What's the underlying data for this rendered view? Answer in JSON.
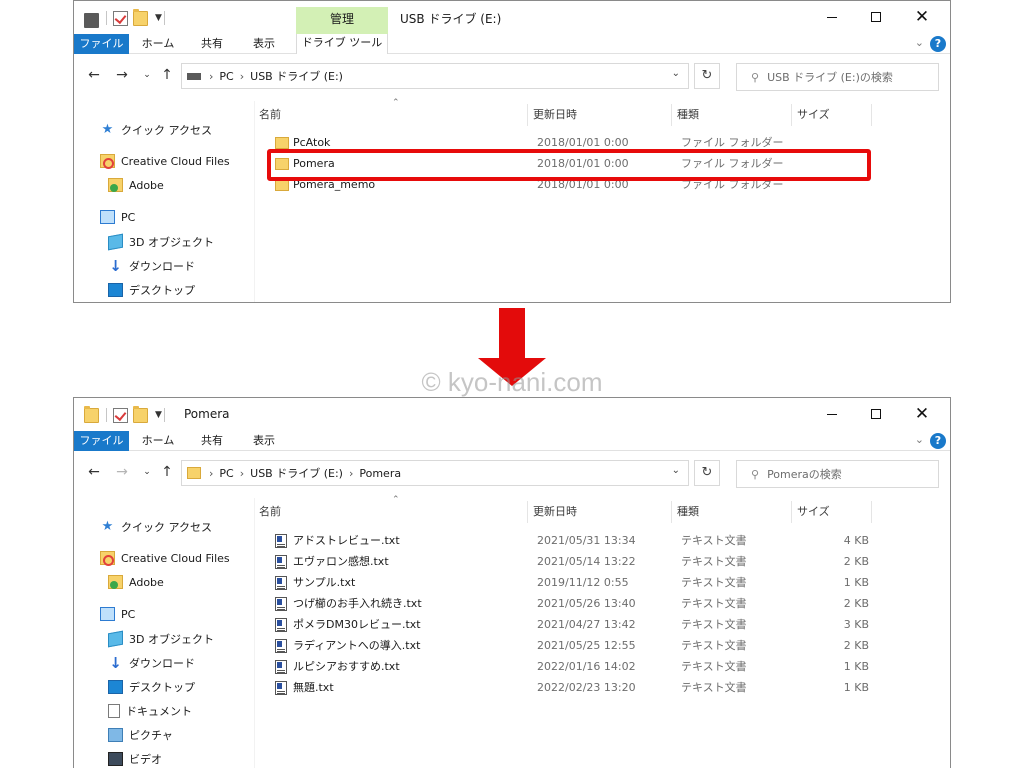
{
  "before": {
    "window_title": "USB ドライブ (E:)",
    "context_tab_group": "管理",
    "ribbon_tabs": [
      "ファイル",
      "ホーム",
      "共有",
      "表示"
    ],
    "context_tab": "ドライブ ツール",
    "address": [
      "PC",
      "USB ドライブ (E:)"
    ],
    "search_placeholder": "USB ドライブ (E:)の検索",
    "nav_items": [
      "クイック アクセス",
      "Creative Cloud Files",
      "Adobe",
      "PC",
      "3D オブジェクト",
      "ダウンロード",
      "デスクトップ"
    ],
    "columns": [
      "名前",
      "更新日時",
      "種類",
      "サイズ"
    ],
    "files": [
      {
        "name": "PcAtok",
        "date": "2018/01/01 0:00",
        "type": "ファイル フォルダー",
        "size": ""
      },
      {
        "name": "Pomera",
        "date": "2018/01/01 0:00",
        "type": "ファイル フォルダー",
        "size": ""
      },
      {
        "name": "Pomera_memo",
        "date": "2018/01/01 0:00",
        "type": "ファイル フォルダー",
        "size": ""
      }
    ]
  },
  "after": {
    "window_title": "Pomera",
    "ribbon_tabs": [
      "ファイル",
      "ホーム",
      "共有",
      "表示"
    ],
    "address": [
      "PC",
      "USB ドライブ (E:)",
      "Pomera"
    ],
    "search_placeholder": "Pomeraの検索",
    "nav_items": [
      "クイック アクセス",
      "Creative Cloud Files",
      "Adobe",
      "PC",
      "3D オブジェクト",
      "ダウンロード",
      "デスクトップ",
      "ドキュメント",
      "ピクチャ",
      "ビデオ"
    ],
    "columns": [
      "名前",
      "更新日時",
      "種類",
      "サイズ"
    ],
    "files": [
      {
        "name": "アドストレビュー.txt",
        "date": "2021/05/31 13:34",
        "type": "テキスト文書",
        "size": "4 KB"
      },
      {
        "name": "エヴァロン感想.txt",
        "date": "2021/05/14 13:22",
        "type": "テキスト文書",
        "size": "2 KB"
      },
      {
        "name": "サンプル.txt",
        "date": "2019/11/12 0:55",
        "type": "テキスト文書",
        "size": "1 KB"
      },
      {
        "name": "つげ櫛のお手入れ続き.txt",
        "date": "2021/05/26 13:40",
        "type": "テキスト文書",
        "size": "2 KB"
      },
      {
        "name": "ポメラDM30レビュー.txt",
        "date": "2021/04/27 13:42",
        "type": "テキスト文書",
        "size": "3 KB"
      },
      {
        "name": "ラディアントへの導入.txt",
        "date": "2021/05/25 12:55",
        "type": "テキスト文書",
        "size": "2 KB"
      },
      {
        "name": "ルピシアおすすめ.txt",
        "date": "2022/01/16 14:02",
        "type": "テキスト文書",
        "size": "1 KB"
      },
      {
        "name": "無題.txt",
        "date": "2022/02/23 13:20",
        "type": "テキスト文書",
        "size": "1 KB"
      }
    ]
  },
  "watermark": "© kyo-nani.com",
  "colors": {
    "accent": "#1979ca",
    "highlight": "#e70b0b",
    "context_tab": "#d3f0b5"
  }
}
